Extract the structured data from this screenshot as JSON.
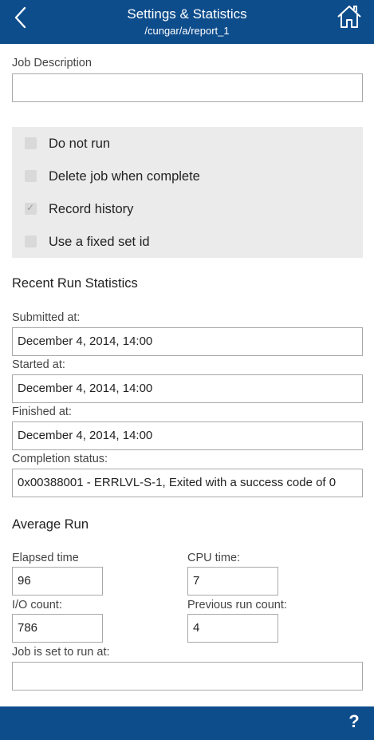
{
  "header": {
    "title": "Settings & Statistics",
    "subtitle": "/cungar/a/report_1",
    "back_icon": "chevron-left-icon",
    "home_icon": "home-icon"
  },
  "job_description": {
    "label": "Job Description",
    "value": ""
  },
  "options": [
    {
      "label": "Do not run",
      "checked": false
    },
    {
      "label": "Delete job when complete",
      "checked": false
    },
    {
      "label": "Record history",
      "checked": true
    },
    {
      "label": "Use a fixed set id",
      "checked": false
    }
  ],
  "recent": {
    "heading": "Recent Run Statistics",
    "submitted_label": "Submitted at:",
    "submitted_value": "December 4, 2014, 14:00",
    "started_label": "Started at:",
    "started_value": "December 4, 2014, 14:00",
    "finished_label": "Finished at:",
    "finished_value": "December 4, 2014, 14:00",
    "completion_label": "Completion status:",
    "completion_value": "0x00388001 - ERRLVL-S-1, Exited with a success code of 0"
  },
  "average": {
    "heading": "Average Run",
    "elapsed_label": "Elapsed time",
    "elapsed_value": "96",
    "cpu_label": "CPU time:",
    "cpu_value": "7",
    "io_label": "I/O count:",
    "io_value": "786",
    "prev_label": "Previous run count:",
    "prev_value": "4",
    "run_at_label": "Job is set to run at:",
    "run_at_value": ""
  },
  "footer": {
    "help_label": "?"
  },
  "colors": {
    "brand_blue": "#0e4d8c",
    "panel_gray": "#ebebeb"
  }
}
